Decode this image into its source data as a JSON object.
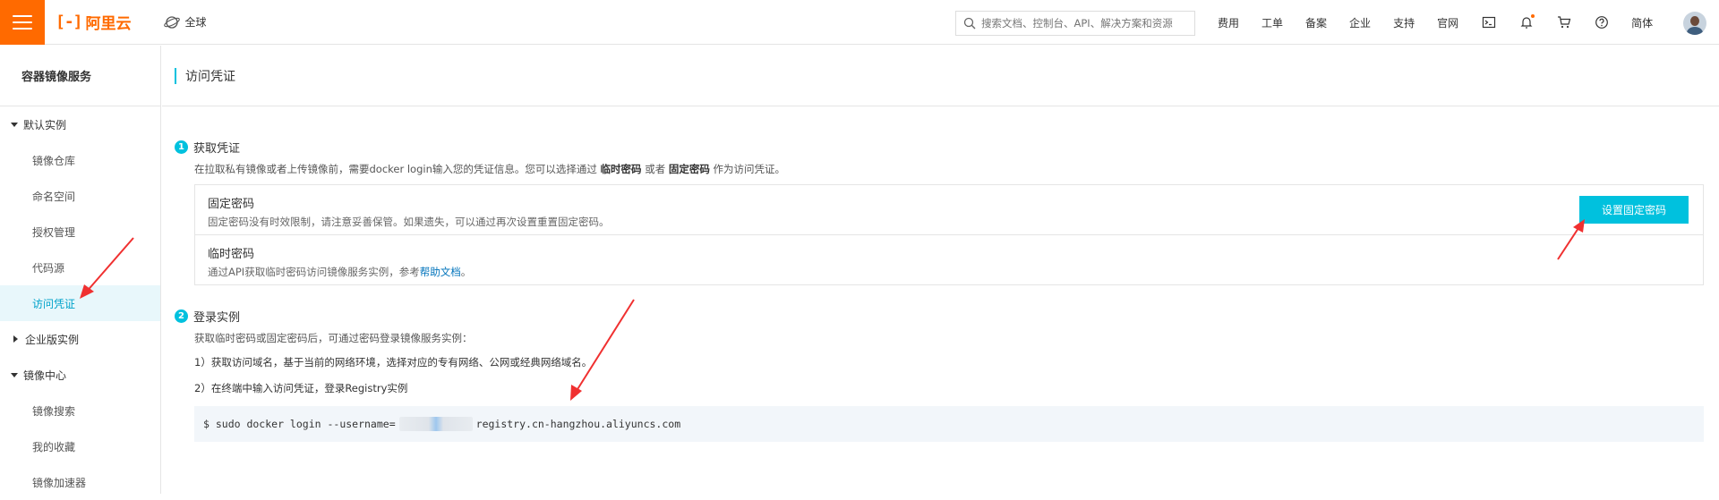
{
  "brand": {
    "logo_mark": "[-]",
    "logo_text": "阿里云",
    "color": "#ff6a00"
  },
  "header": {
    "region": "全球",
    "search_placeholder": "搜索文档、控制台、API、解决方案和资源",
    "links": [
      "费用",
      "工单",
      "备案",
      "企业",
      "支持",
      "官网"
    ],
    "icons": [
      "terminal-icon",
      "bell-icon",
      "cart-icon",
      "help-icon"
    ],
    "language": "简体"
  },
  "sidebar": {
    "title": "容器镜像服务",
    "groups": [
      {
        "label": "默认实例",
        "expanded": true,
        "items": [
          "镜像仓库",
          "命名空间",
          "授权管理",
          "代码源",
          "访问凭证"
        ]
      },
      {
        "label": "企业版实例",
        "expanded": false,
        "items": []
      },
      {
        "label": "镜像中心",
        "expanded": true,
        "items": [
          "镜像搜索",
          "我的收藏",
          "镜像加速器"
        ]
      }
    ],
    "active_item": "访问凭证"
  },
  "page": {
    "title": "访问凭证",
    "accent_color": "#00c1de",
    "section1": {
      "number": "1",
      "title": "获取凭证",
      "desc_prefix": "在拉取私有镜像或者上传镜像前，需要docker login输入您的凭证信息。您可以选择通过",
      "desc_opt1": "临时密码",
      "desc_mid": "或者",
      "desc_opt2": "固定密码",
      "desc_suffix": "作为访问凭证。",
      "fixed": {
        "name": "固定密码",
        "desc": "固定密码没有时效限制，请注意妥善保管。如果遗失，可以通过再次设置重置固定密码。",
        "button": "设置固定密码"
      },
      "temp": {
        "name": "临时密码",
        "desc_prefix": "通过API获取临时密码访问镜像服务实例，参考",
        "link": "帮助文档",
        "desc_suffix": "。"
      }
    },
    "section2": {
      "number": "2",
      "title": "登录实例",
      "desc": "获取临时密码或固定密码后，可通过密码登录镜像服务实例：",
      "step1": "1）获取访问域名，基于当前的网络环境，选择对应的专有网络、公网或经典网络域名。",
      "step2": "2）在终端中输入访问凭证，登录Registry实例",
      "command_prefix": "$ sudo docker login --username=",
      "command_suffix": " registry.cn-hangzhou.aliyuncs.com"
    }
  }
}
